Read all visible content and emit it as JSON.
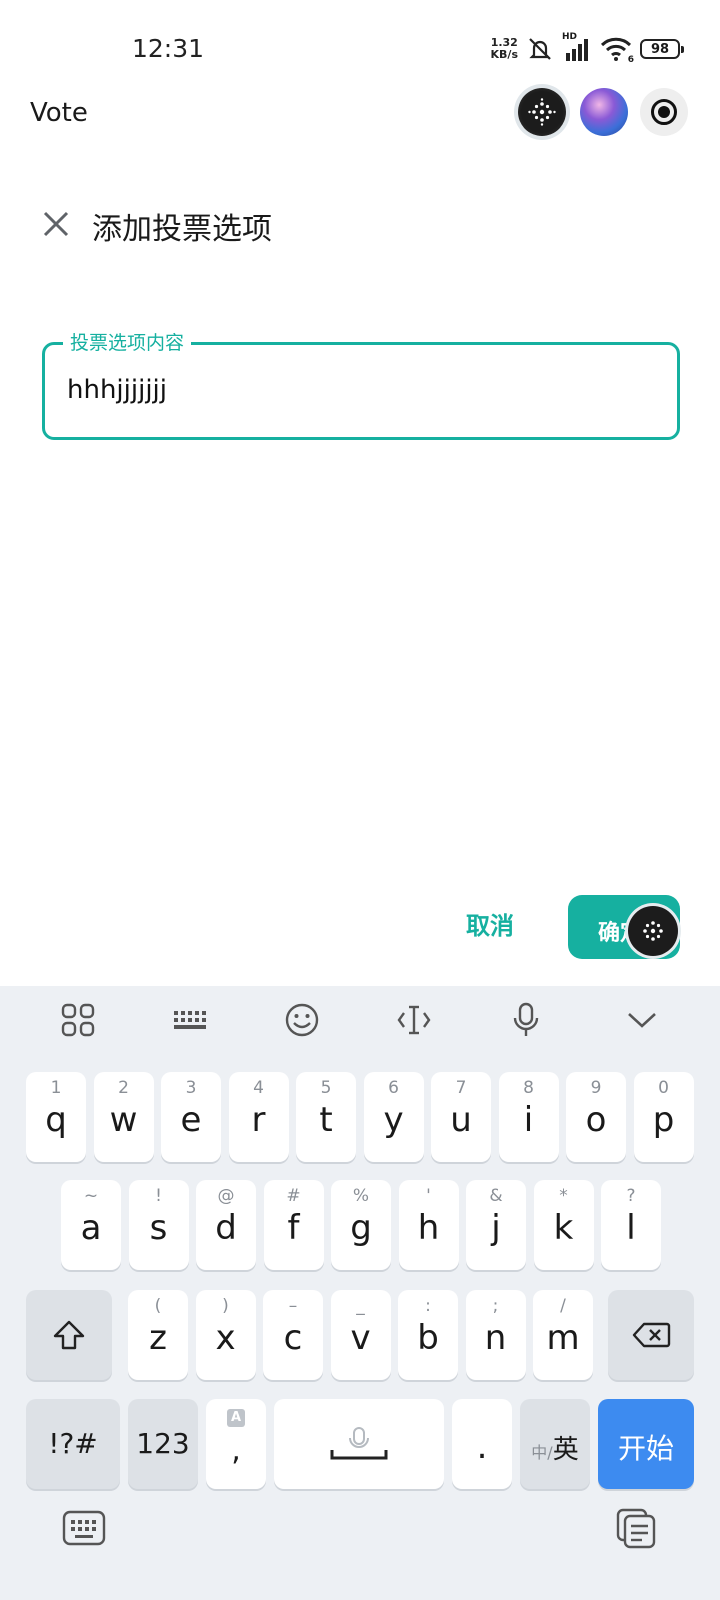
{
  "status_bar": {
    "time": "12:31",
    "net_speed_value": "1.32",
    "net_speed_unit": "KB/s",
    "network_tag": "HD",
    "wifi_tag": "6",
    "battery": "98"
  },
  "app": {
    "title": "Vote"
  },
  "dialog": {
    "title": "添加投票选项",
    "field_label": "投票选项内容",
    "field_value": "hhhjjjjjjj",
    "cancel_label": "取消",
    "confirm_label": "确定"
  },
  "keyboard": {
    "row1": [
      {
        "hint": "1",
        "ch": "q"
      },
      {
        "hint": "2",
        "ch": "w"
      },
      {
        "hint": "3",
        "ch": "e"
      },
      {
        "hint": "4",
        "ch": "r"
      },
      {
        "hint": "5",
        "ch": "t"
      },
      {
        "hint": "6",
        "ch": "y"
      },
      {
        "hint": "7",
        "ch": "u"
      },
      {
        "hint": "8",
        "ch": "i"
      },
      {
        "hint": "9",
        "ch": "o"
      },
      {
        "hint": "0",
        "ch": "p"
      }
    ],
    "row2": [
      {
        "hint": "~",
        "ch": "a"
      },
      {
        "hint": "!",
        "ch": "s"
      },
      {
        "hint": "@",
        "ch": "d"
      },
      {
        "hint": "#",
        "ch": "f"
      },
      {
        "hint": "%",
        "ch": "g"
      },
      {
        "hint": "'",
        "ch": "h"
      },
      {
        "hint": "&",
        "ch": "j"
      },
      {
        "hint": "*",
        "ch": "k"
      },
      {
        "hint": "?",
        "ch": "l"
      }
    ],
    "row3": [
      {
        "hint": "(",
        "ch": "z"
      },
      {
        "hint": ")",
        "ch": "x"
      },
      {
        "hint": "–",
        "ch": "c"
      },
      {
        "hint": "_",
        "ch": "v"
      },
      {
        "hint": ":",
        "ch": "b"
      },
      {
        "hint": ";",
        "ch": "n"
      },
      {
        "hint": "/",
        "ch": "m"
      }
    ],
    "symbols_label": "!?#",
    "numbers_label": "123",
    "comma": ",",
    "comma_hint": "A",
    "period": ".",
    "lang_small": "中/",
    "lang_big": "英",
    "enter_label": "开始"
  }
}
